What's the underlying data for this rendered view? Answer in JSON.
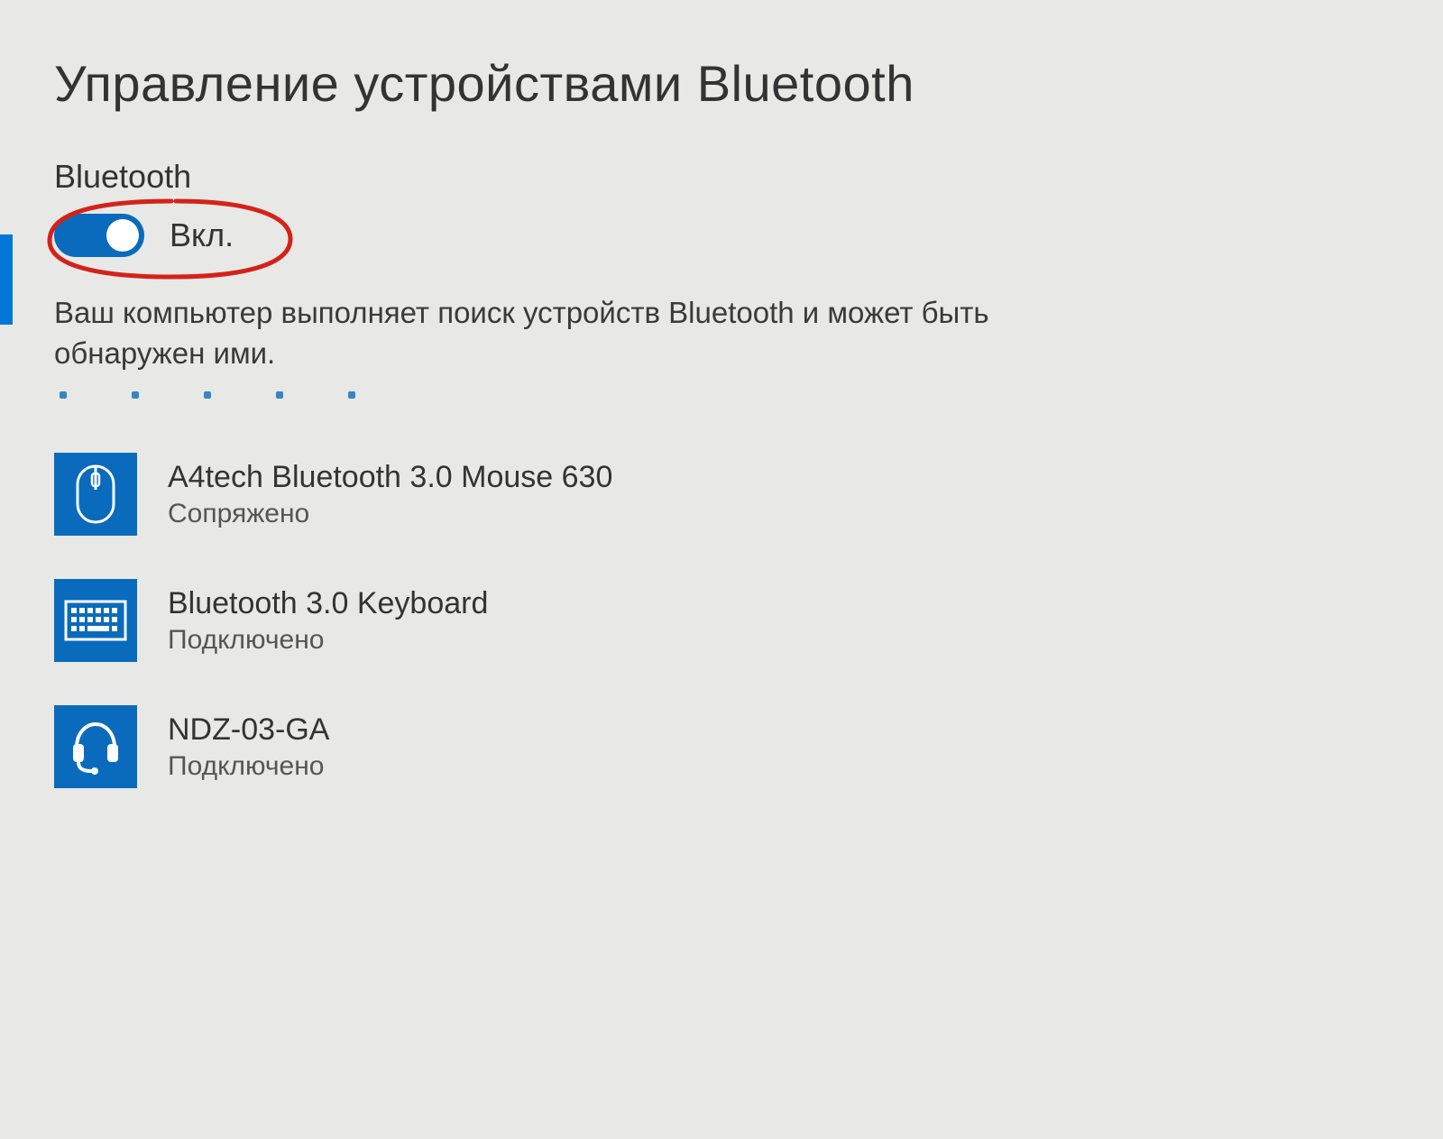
{
  "page": {
    "title": "Управление устройствами Bluetooth"
  },
  "bluetooth": {
    "section_label": "Bluetooth",
    "toggle_state_label": "Вкл.",
    "status_text": "Ваш компьютер выполняет поиск устройств Bluetooth и может быть обнаружен ими."
  },
  "devices": [
    {
      "name": "A4tech Bluetooth 3.0 Mouse 630",
      "status": "Сопряжено",
      "icon": "mouse"
    },
    {
      "name": "Bluetooth 3.0 Keyboard",
      "status": "Подключено",
      "icon": "keyboard"
    },
    {
      "name": "NDZ-03-GA",
      "status": "Подключено",
      "icon": "headset"
    }
  ],
  "colors": {
    "accent": "#0a6bbd",
    "background": "#e8e9e6"
  }
}
